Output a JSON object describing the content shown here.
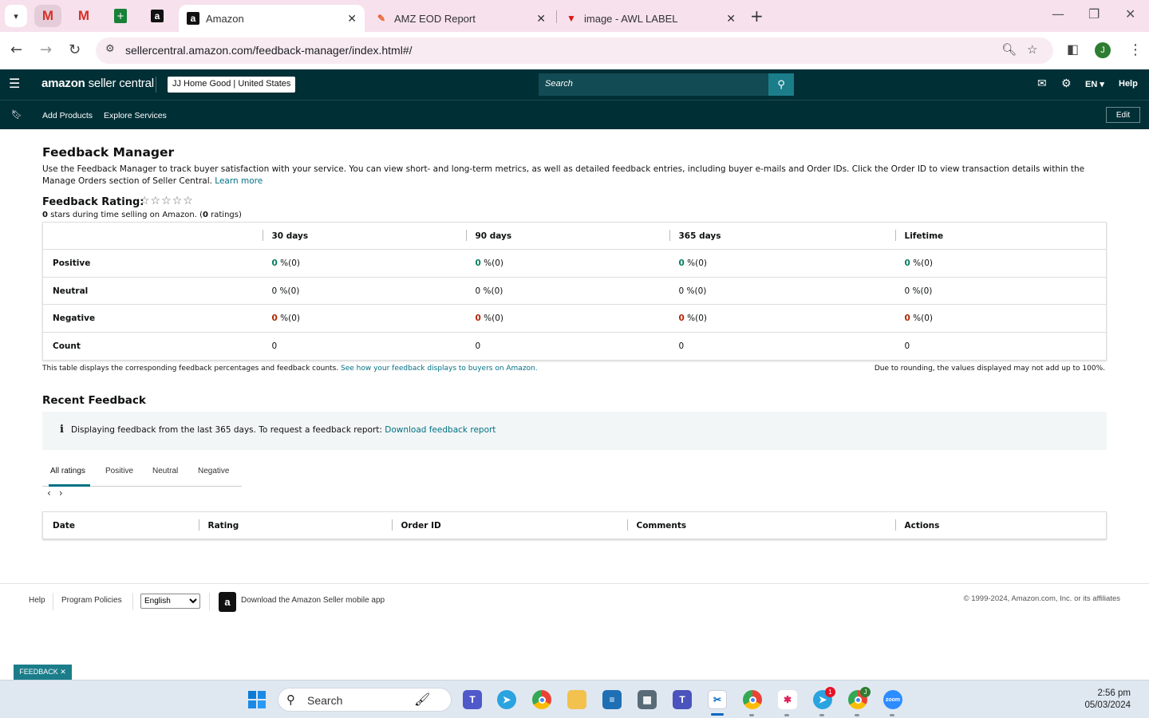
{
  "browser": {
    "tabs": [
      {
        "title": "Amazon",
        "active": true
      },
      {
        "title": "AMZ EOD Report",
        "active": false
      },
      {
        "title": "image - AWL LABEL",
        "active": false
      }
    ],
    "pinned_tabs": [
      "gmail-icon",
      "gmail-icon",
      "google-sheets-icon",
      "amazon-icon"
    ],
    "url": "sellercentral.amazon.com/feedback-manager/index.html#/",
    "profile_initial": "J"
  },
  "header": {
    "logo_brand": "amazon",
    "logo_rest": " seller central",
    "account": "JJ Home Good | United States",
    "search_placeholder": "Search",
    "language": "EN",
    "help": "Help"
  },
  "subnav": {
    "links": [
      "Add Products",
      "Explore Services"
    ],
    "edit": "Edit"
  },
  "page": {
    "title": "Feedback Manager",
    "intro": "Use the Feedback Manager to track buyer satisfaction with your service. You can view short- and long-term metrics, as well as detailed feedback entries, including buyer e-mails and Order IDs. Click the Order ID to view transaction details within the Manage Orders section of Seller Central.",
    "learn_more": "Learn more",
    "rating_label": "Feedback Rating:",
    "stars": "☆☆☆☆☆",
    "stars_count": "0",
    "stars_text": " stars during time selling on Amazon. (",
    "ratings_count": "0",
    "ratings_text": " ratings)"
  },
  "feedback_table": {
    "columns": [
      "30 days",
      "90 days",
      "365 days",
      "Lifetime"
    ],
    "rows": [
      {
        "label": "Positive",
        "cells": [
          "0",
          "0",
          "0",
          "0"
        ],
        "suffix": " %(0)"
      },
      {
        "label": "Neutral",
        "cells": [
          "0",
          "0",
          "0",
          "0"
        ],
        "suffix": " %(0)"
      },
      {
        "label": "Negative",
        "cells": [
          "0",
          "0",
          "0",
          "0"
        ],
        "suffix": " %(0)"
      },
      {
        "label": "Count",
        "cells": [
          "0",
          "0",
          "0",
          "0"
        ],
        "suffix": ""
      }
    ],
    "note": "This table displays the corresponding feedback percentages and feedback counts.",
    "note_link": "See how your feedback displays to buyers on Amazon.",
    "rounding": "Due to rounding, the values displayed may not add up to 100%."
  },
  "recent": {
    "title": "Recent Feedback",
    "info": "Displaying feedback from the last 365 days. To request a feedback report:",
    "info_link": "Download feedback report",
    "tabs": [
      "All ratings",
      "Positive",
      "Neutral",
      "Negative"
    ],
    "columns": [
      "Date",
      "Rating",
      "Order ID",
      "Comments",
      "Actions"
    ]
  },
  "footer": {
    "help": "Help",
    "policies": "Program Policies",
    "language": "English",
    "app": "Download the Amazon Seller mobile app",
    "copyright": "© 1999-2024, Amazon.com, Inc. or its affiliates"
  },
  "feedback_tag": "FEEDBACK ✕",
  "taskbar": {
    "search": "Search",
    "time": "2:56 pm",
    "date": "05/03/2024",
    "telegram_badge": "1",
    "chrome_badge": "J"
  },
  "colors": {
    "header_bg": "#002f36",
    "accent": "#007185",
    "positive": "#067d62",
    "negative": "#b12704"
  }
}
